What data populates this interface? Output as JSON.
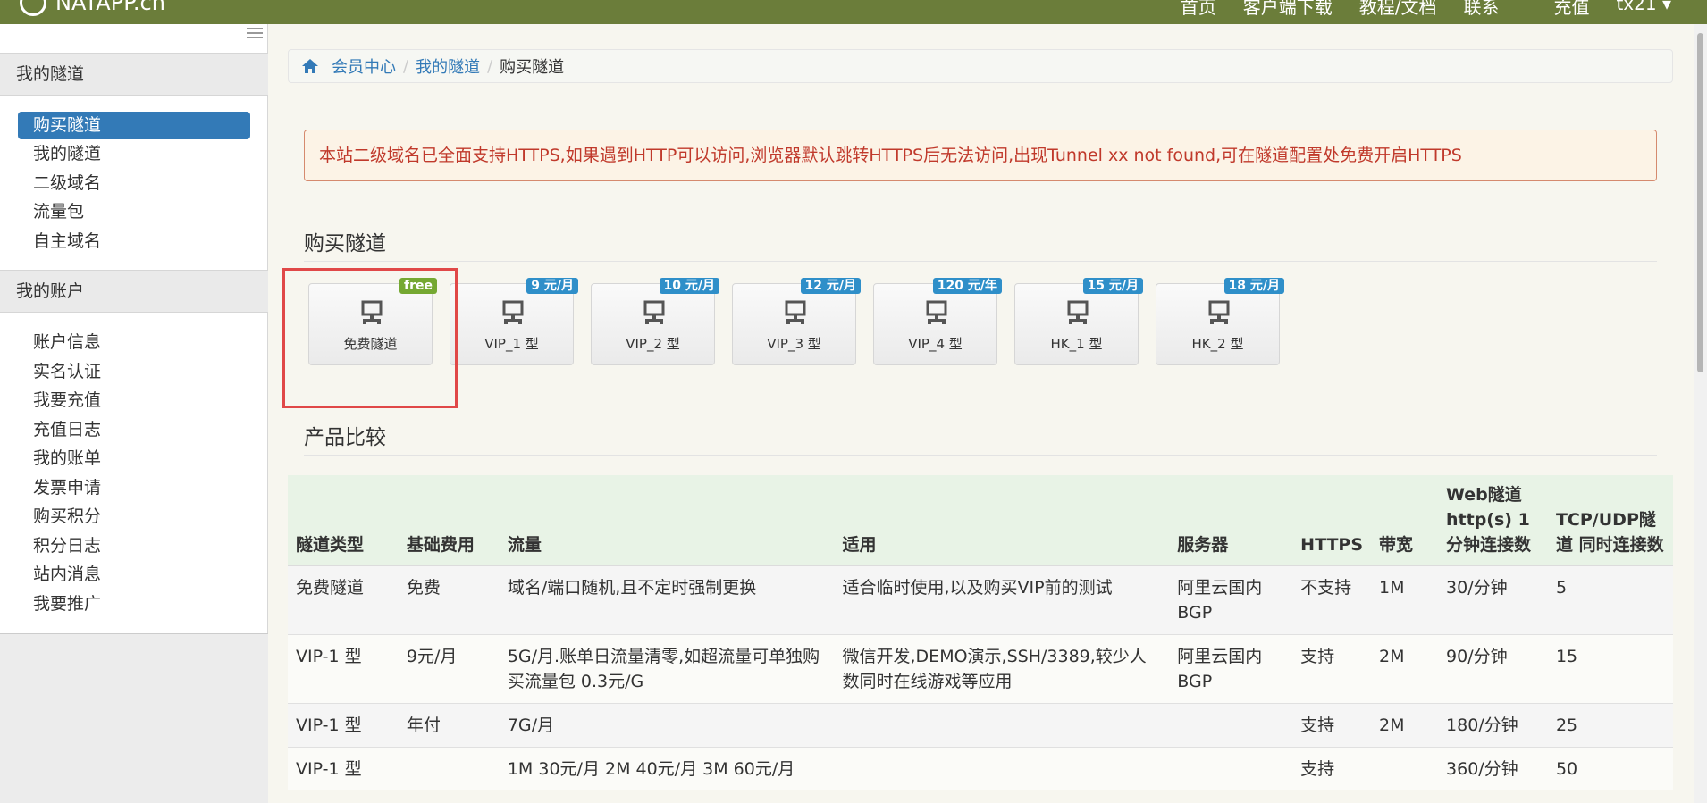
{
  "topbar": {
    "logo_text": "NATAPP.cn",
    "nav": [
      "首页",
      "客户端下载",
      "教程/文档",
      "联系"
    ],
    "recharge": "充值",
    "user": "tx21 ▾"
  },
  "sidebar": {
    "section1_title": "我的隧道",
    "section1_items": [
      "购买隧道",
      "我的隧道",
      "二级域名",
      "流量包",
      "自主域名"
    ],
    "section2_title": "我的账户",
    "section2_items": [
      "账户信息",
      "实名认证",
      "我要充值",
      "充值日志",
      "我的账单",
      "发票申请",
      "购买积分",
      "积分日志",
      "站内消息",
      "我要推广"
    ]
  },
  "breadcrumb": {
    "items": [
      "会员中心",
      "我的隧道"
    ],
    "current": "购买隧道"
  },
  "alert": "本站二级域名已全面支持HTTPS,如果遇到HTTP可以访问,浏览器默认跳转HTTPS后无法访问,出现Tunnel xx not found,可在隧道配置处免费开启HTTPS",
  "buy_title": "购买隧道",
  "tiles": [
    {
      "label": "免费隧道",
      "badge": "free"
    },
    {
      "label": "VIP_1 型",
      "badge": "9 元/月"
    },
    {
      "label": "VIP_2 型",
      "badge": "10 元/月"
    },
    {
      "label": "VIP_3 型",
      "badge": "12 元/月"
    },
    {
      "label": "VIP_4 型",
      "badge": "120 元/年"
    },
    {
      "label": "HK_1 型",
      "badge": "15 元/月"
    },
    {
      "label": "HK_2 型",
      "badge": "18 元/月"
    }
  ],
  "compare_title": "产品比较",
  "table": {
    "headers": [
      "隧道类型",
      "基础费用",
      "流量",
      "适用",
      "服务器",
      "HTTPS",
      "带宽",
      "Web隧道 http(s) 1分钟连接数",
      "TCP/UDP隧道 同时连接数"
    ],
    "rows": [
      [
        "免费隧道",
        "免费",
        "域名/端口随机,且不定时强制更换",
        "适合临时使用,以及购买VIP前的测试",
        "阿里云国内BGP",
        "不支持",
        "1M",
        "30/分钟",
        "5"
      ],
      [
        "VIP-1 型",
        "9元/月",
        "5G/月.账单日流量清零,如超流量可单独购买流量包 0.3元/G",
        "微信开发,DEMO演示,SSH/3389,较少人数同时在线游戏等应用",
        "阿里云国内BGP",
        "支持",
        "2M",
        "90/分钟",
        "15"
      ],
      [
        "VIP-1 型",
        "年付",
        "7G/月",
        "",
        "",
        "支持",
        "2M",
        "180/分钟",
        "25"
      ],
      [
        "VIP-1 型",
        "",
        "1M 30元/月 2M 40元/月 3M 60元/月",
        "",
        "",
        "支持",
        "",
        "360/分钟",
        "50"
      ]
    ]
  }
}
